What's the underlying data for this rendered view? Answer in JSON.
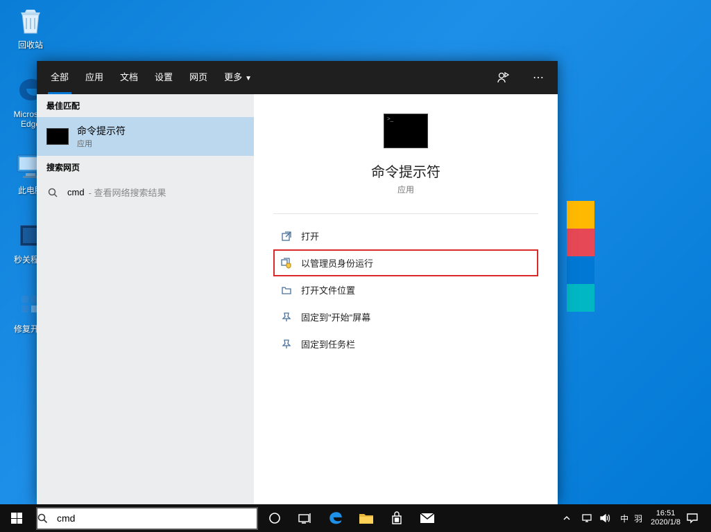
{
  "desktop": {
    "icons": [
      {
        "label": "回收站"
      },
      {
        "label": "Microsoft Edge"
      },
      {
        "label": "此电脑"
      },
      {
        "label": "秒关程序"
      },
      {
        "label": "修复开机"
      }
    ]
  },
  "search_panel": {
    "tabs": [
      "全部",
      "应用",
      "文档",
      "设置",
      "网页"
    ],
    "more_label": "更多",
    "sections": {
      "best_match": "最佳匹配",
      "search_web": "搜索网页"
    },
    "best_match_item": {
      "title": "命令提示符",
      "subtitle": "应用"
    },
    "web_item": {
      "query": "cmd",
      "hint": "- 查看网络搜索结果"
    },
    "details": {
      "title": "命令提示符",
      "subtitle": "应用",
      "actions": [
        {
          "label": "打开"
        },
        {
          "label": "以管理员身份运行"
        },
        {
          "label": "打开文件位置"
        },
        {
          "label": "固定到\"开始\"屏幕"
        },
        {
          "label": "固定到任务栏"
        }
      ],
      "highlight_index": 1
    }
  },
  "taskbar": {
    "search_value": "cmd",
    "ime": "中",
    "ime2": "羽",
    "time": "16:51",
    "date": "2020/1/8"
  }
}
